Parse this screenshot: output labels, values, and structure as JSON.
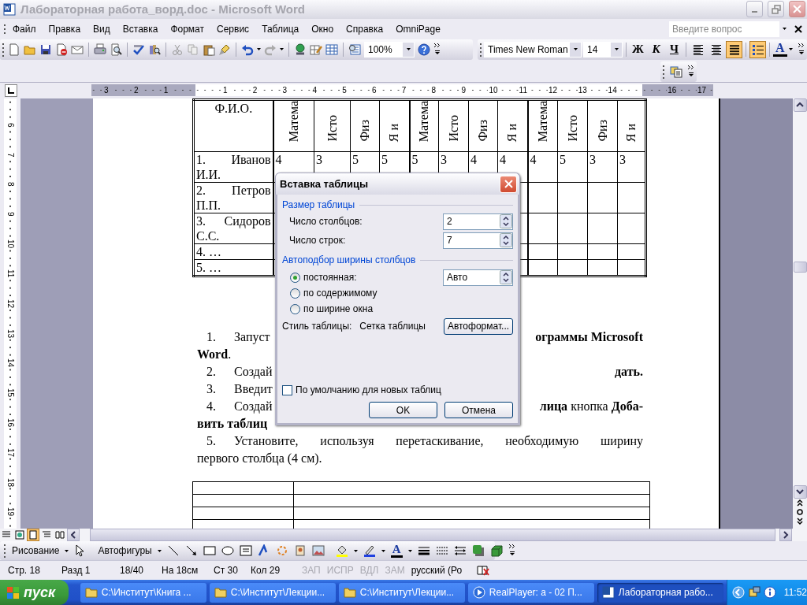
{
  "window": {
    "title": "Лабораторная работа_ворд.doc - Microsoft Word",
    "active": false
  },
  "menu": {
    "items": [
      "Файл",
      "Правка",
      "Вид",
      "Вставка",
      "Формат",
      "Сервис",
      "Таблица",
      "Окно",
      "Справка",
      "OmniPage"
    ],
    "help_box": {
      "placeholder": "Введите вопрос"
    }
  },
  "standard_toolbar": {
    "zoom": "100%"
  },
  "formatting_toolbar": {
    "font": "Times New Roman",
    "size": "14",
    "style_buttons": [
      "Ж",
      "К",
      "Ч"
    ],
    "align_buttons": [
      {
        "kind": "left",
        "selected": false
      },
      {
        "kind": "center",
        "selected": false
      },
      {
        "kind": "justify",
        "selected": true
      }
    ],
    "numbering": {
      "selected": true
    },
    "font_color": "A"
  },
  "ruler": {
    "left_numbers": [
      "3",
      "2",
      "1"
    ],
    "numbers": [
      "1",
      "2",
      "3",
      "4",
      "5",
      "6",
      "7",
      "8",
      "9",
      "10",
      "11",
      "12",
      "13",
      "14"
    ],
    "right_numbers": [
      "16",
      "17"
    ]
  },
  "vertical_ruler": {
    "numbers": [
      "6",
      "7",
      "8",
      "9",
      "10",
      "11",
      "12",
      "13",
      "14",
      "15",
      "16",
      "17",
      "18",
      "19"
    ]
  },
  "document": {
    "grade_table": {
      "name_header": "Ф.И.О.",
      "subject_headers": [
        "Матема",
        "Исто",
        "Физ",
        "Я и",
        "Матема",
        "Исто",
        "Физ",
        "Я и",
        "Матема",
        "Исто",
        "Физ",
        "Я и"
      ],
      "rows": [
        {
          "name": "1. Иванов И.И.",
          "values": [
            "4",
            "3",
            "5",
            "5",
            "5",
            "3",
            "4",
            "4",
            "4",
            "5",
            "3",
            "3"
          ]
        },
        {
          "name": "2. Петров П.П."
        },
        {
          "name": "3. Сидоров С.С."
        },
        {
          "name": "4. …"
        },
        {
          "name": "5. …"
        }
      ]
    },
    "lines": [
      {
        "kind": "numbered",
        "number": "1.",
        "left": {
          "text": "Запуст",
          "bold": false
        },
        "right": {
          "text": "ограммы Microsoft",
          "bold": true
        }
      },
      {
        "kind": "continuation",
        "left": {
          "text": "**Word**.",
          "bold": false
        }
      },
      {
        "kind": "numbered",
        "number": "2.",
        "left": {
          "text": "Создай",
          "bold": false
        },
        "right": {
          "text": "дать.",
          "bold": true
        }
      },
      {
        "kind": "numbered",
        "number": "3.",
        "left": {
          "text": "Введит",
          "bold": false
        }
      },
      {
        "kind": "numbered",
        "number": "4.",
        "left": {
          "text": "Создай",
          "bold": false
        },
        "right": {
          "text": "**лица** кнопка **Доба-**",
          "bold": false
        }
      },
      {
        "kind": "continuation",
        "left": {
          "text": "вить таблиц",
          "bold": true
        }
      },
      {
        "kind": "justified",
        "number": "5.",
        "left": {
          "text": "Установите, используя перетаскивание, необходимую ширину",
          "bold": false
        }
      },
      {
        "kind": "continuation",
        "left": {
          "text": "первого столбца (4 см).",
          "bold": false
        }
      }
    ]
  },
  "view_buttons": [
    {
      "kind": "normal",
      "selected": false
    },
    {
      "kind": "web",
      "selected": false
    },
    {
      "kind": "print",
      "selected": true
    },
    {
      "kind": "outline",
      "selected": false
    },
    {
      "kind": "reading",
      "selected": false
    }
  ],
  "drawing_toolbar": {
    "draw_menu": "Рисование",
    "autoshapes_menu": "Автофигуры",
    "font_color": "A"
  },
  "status_bar": {
    "fields": [
      "Стр. 18",
      "Разд 1",
      "18/40",
      "На 18см",
      "Ст 30",
      "Кол 29"
    ],
    "modes": [
      {
        "label": "ЗАП",
        "on": false
      },
      {
        "label": "ИСПР",
        "on": false
      },
      {
        "label": "ВДЛ",
        "on": false
      },
      {
        "label": "ЗАМ",
        "on": false
      }
    ],
    "language": "русский (Ро"
  },
  "taskbar": {
    "start": "пуск",
    "tasks": [
      {
        "kind": "folder",
        "label": "C:\\Институт\\Книга ...",
        "selected": false
      },
      {
        "kind": "folder",
        "label": "C:\\Институт\\Лекции...",
        "selected": false
      },
      {
        "kind": "folder",
        "label": "C:\\Институт\\Лекции...",
        "selected": false
      },
      {
        "kind": "player",
        "label": "RealPlayer: a - 02  П...",
        "selected": false
      },
      {
        "kind": "word",
        "label": "Лабораторная рабо...",
        "selected": true
      }
    ],
    "clock": "11:52"
  },
  "dialog": {
    "title": "Вставка таблицы",
    "size_group": "Размер таблицы",
    "columns": {
      "label": "Число столбцов:",
      "value": "2"
    },
    "rows": {
      "label": "Число строк:",
      "value": "7"
    },
    "autofit_group": "Автоподбор ширины столбцов",
    "autofit_options": [
      {
        "label": "постоянная:",
        "selected": true,
        "value": "Авто"
      },
      {
        "label": "по содержимому",
        "selected": false
      },
      {
        "label": "по ширине окна",
        "selected": false
      }
    ],
    "style_label": "Стиль таблицы:",
    "style_value": "Сетка таблицы",
    "autoformat_button": "Автоформат...",
    "default_checkbox": {
      "label": "По умолчанию для новых таблиц",
      "checked": false
    },
    "buttons": [
      "OK",
      "Отмена"
    ]
  }
}
